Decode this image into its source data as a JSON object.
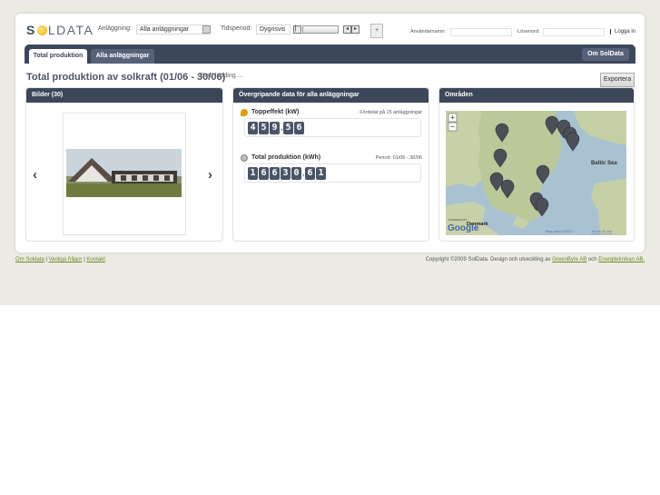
{
  "logo": {
    "prefix": "S",
    "suffix": "LDATA"
  },
  "filters": {
    "anlaggning_label": "Anläggning:",
    "anlaggning_value": "Alla anläggningar",
    "tidsperiod_label": "Tidsperiod:",
    "tidsperiod_value": "Dygnsvis",
    "plus_button": "+"
  },
  "login": {
    "username_label": "Användarnamn:",
    "password_label": "Lösenord:",
    "login_link": "Logga in"
  },
  "nav": {
    "tabs": [
      {
        "label": "Total produktion",
        "active": true
      },
      {
        "label": "Alla anläggningar",
        "active": false
      }
    ],
    "right_tab": "Om SolData"
  },
  "main": {
    "title": "Total produktion av solkraft (01/06 - 30/06)",
    "chart_loading": "Chart loading ...",
    "export_button": "Exportera"
  },
  "panels": {
    "images": {
      "title": "Bilder (30)"
    },
    "overview": {
      "title": "Övergripande data för alla anläggningar",
      "peak": {
        "label": "Toppeffekt (kW)",
        "note": "Fördelat på 15 anläggningar",
        "value": "459,56"
      },
      "total": {
        "label": "Total produktion (kWh)",
        "note": "Period: 01/06 - 30/06",
        "value": "16630,61"
      }
    },
    "areas": {
      "title": "Områden"
    }
  },
  "map": {
    "zoom_in": "+",
    "zoom_out": "−",
    "sea_label": "Baltic Sea",
    "country_label": "Danmark",
    "powered_by": "POWERED BY",
    "google": "Google",
    "map_data": "Map data ©2011 -",
    "terms": "Terms of Use",
    "marker_count": 11
  },
  "footer": {
    "links": [
      "Om Soldata",
      "Vanliga frågor",
      "Kontakt"
    ],
    "copyright_text": "Copyright ©2009 SolData. Design och utveckling av",
    "partner1": "GreenByte AB",
    "and": "och",
    "partner2": "Energiteknikan AB."
  },
  "colors": {
    "navbar": "#3c475a",
    "accent_link": "#6d8a2b",
    "background": "#ebeae3",
    "digit": "#4a5568"
  }
}
